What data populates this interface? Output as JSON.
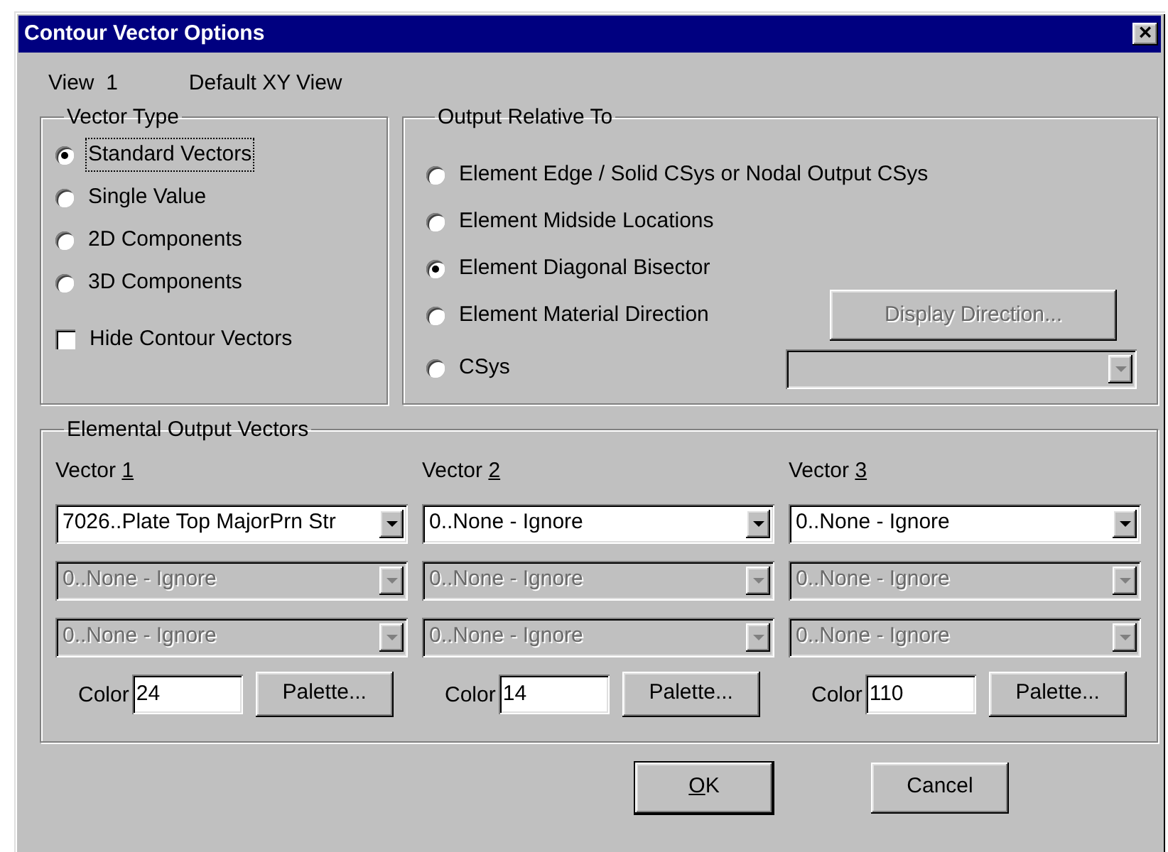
{
  "window": {
    "title": "Contour Vector Options",
    "close": "×"
  },
  "view": {
    "label": "View  1",
    "name": "Default XY View"
  },
  "vector_type": {
    "title": "Vector Type",
    "options": [
      {
        "label": "Standard Vectors",
        "selected": true,
        "focused": true
      },
      {
        "label": "Single Value",
        "selected": false,
        "focused": false
      },
      {
        "label": "2D Components",
        "selected": false,
        "focused": false
      },
      {
        "label": "3D Components",
        "selected": false,
        "focused": false
      }
    ],
    "hide_contour_vectors": {
      "label": "Hide Contour Vectors",
      "checked": false
    }
  },
  "output_relative_to": {
    "title": "Output Relative To",
    "options": [
      {
        "label": "Element Edge / Solid CSys or Nodal Output CSys",
        "selected": false
      },
      {
        "label": "Element Midside Locations",
        "selected": false
      },
      {
        "label": "Element Diagonal Bisector",
        "selected": true
      },
      {
        "label": "Element Material Direction",
        "selected": false
      },
      {
        "label": "CSys",
        "selected": false
      }
    ],
    "display_direction_button": {
      "label": "Display Direction...",
      "disabled": true
    },
    "csys_dropdown": {
      "disabled": true
    }
  },
  "elemental_output_vectors": {
    "title": "Elemental Output Vectors",
    "vectors": [
      {
        "title": "Vector 1",
        "underline_last": true,
        "dropdowns": [
          {
            "value": "7026..Plate Top MajorPrn Str",
            "disabled": false
          },
          {
            "value": "0..None - Ignore",
            "disabled": true
          },
          {
            "value": "0..None - Ignore",
            "disabled": true
          }
        ],
        "color_label": "Color",
        "color_value": "24",
        "palette_button": "Palette..."
      },
      {
        "title": "Vector 2",
        "underline_last": true,
        "dropdowns": [
          {
            "value": "0..None - Ignore",
            "disabled": false
          },
          {
            "value": "0..None - Ignore",
            "disabled": true
          },
          {
            "value": "0..None - Ignore",
            "disabled": true
          }
        ],
        "color_label": "Color",
        "color_value": "14",
        "palette_button": "Palette..."
      },
      {
        "title": "Vector 3",
        "underline_last": true,
        "dropdowns": [
          {
            "value": "0..None - Ignore",
            "disabled": false
          },
          {
            "value": "0..None - Ignore",
            "disabled": true
          },
          {
            "value": "0..None - Ignore",
            "disabled": true
          }
        ],
        "color_label": "Color",
        "color_value": "110",
        "palette_button": "Palette..."
      }
    ]
  },
  "buttons": [
    {
      "label": "OK",
      "underline_first": true,
      "default": true
    },
    {
      "label": "Cancel",
      "underline_first": false,
      "default": false
    }
  ]
}
